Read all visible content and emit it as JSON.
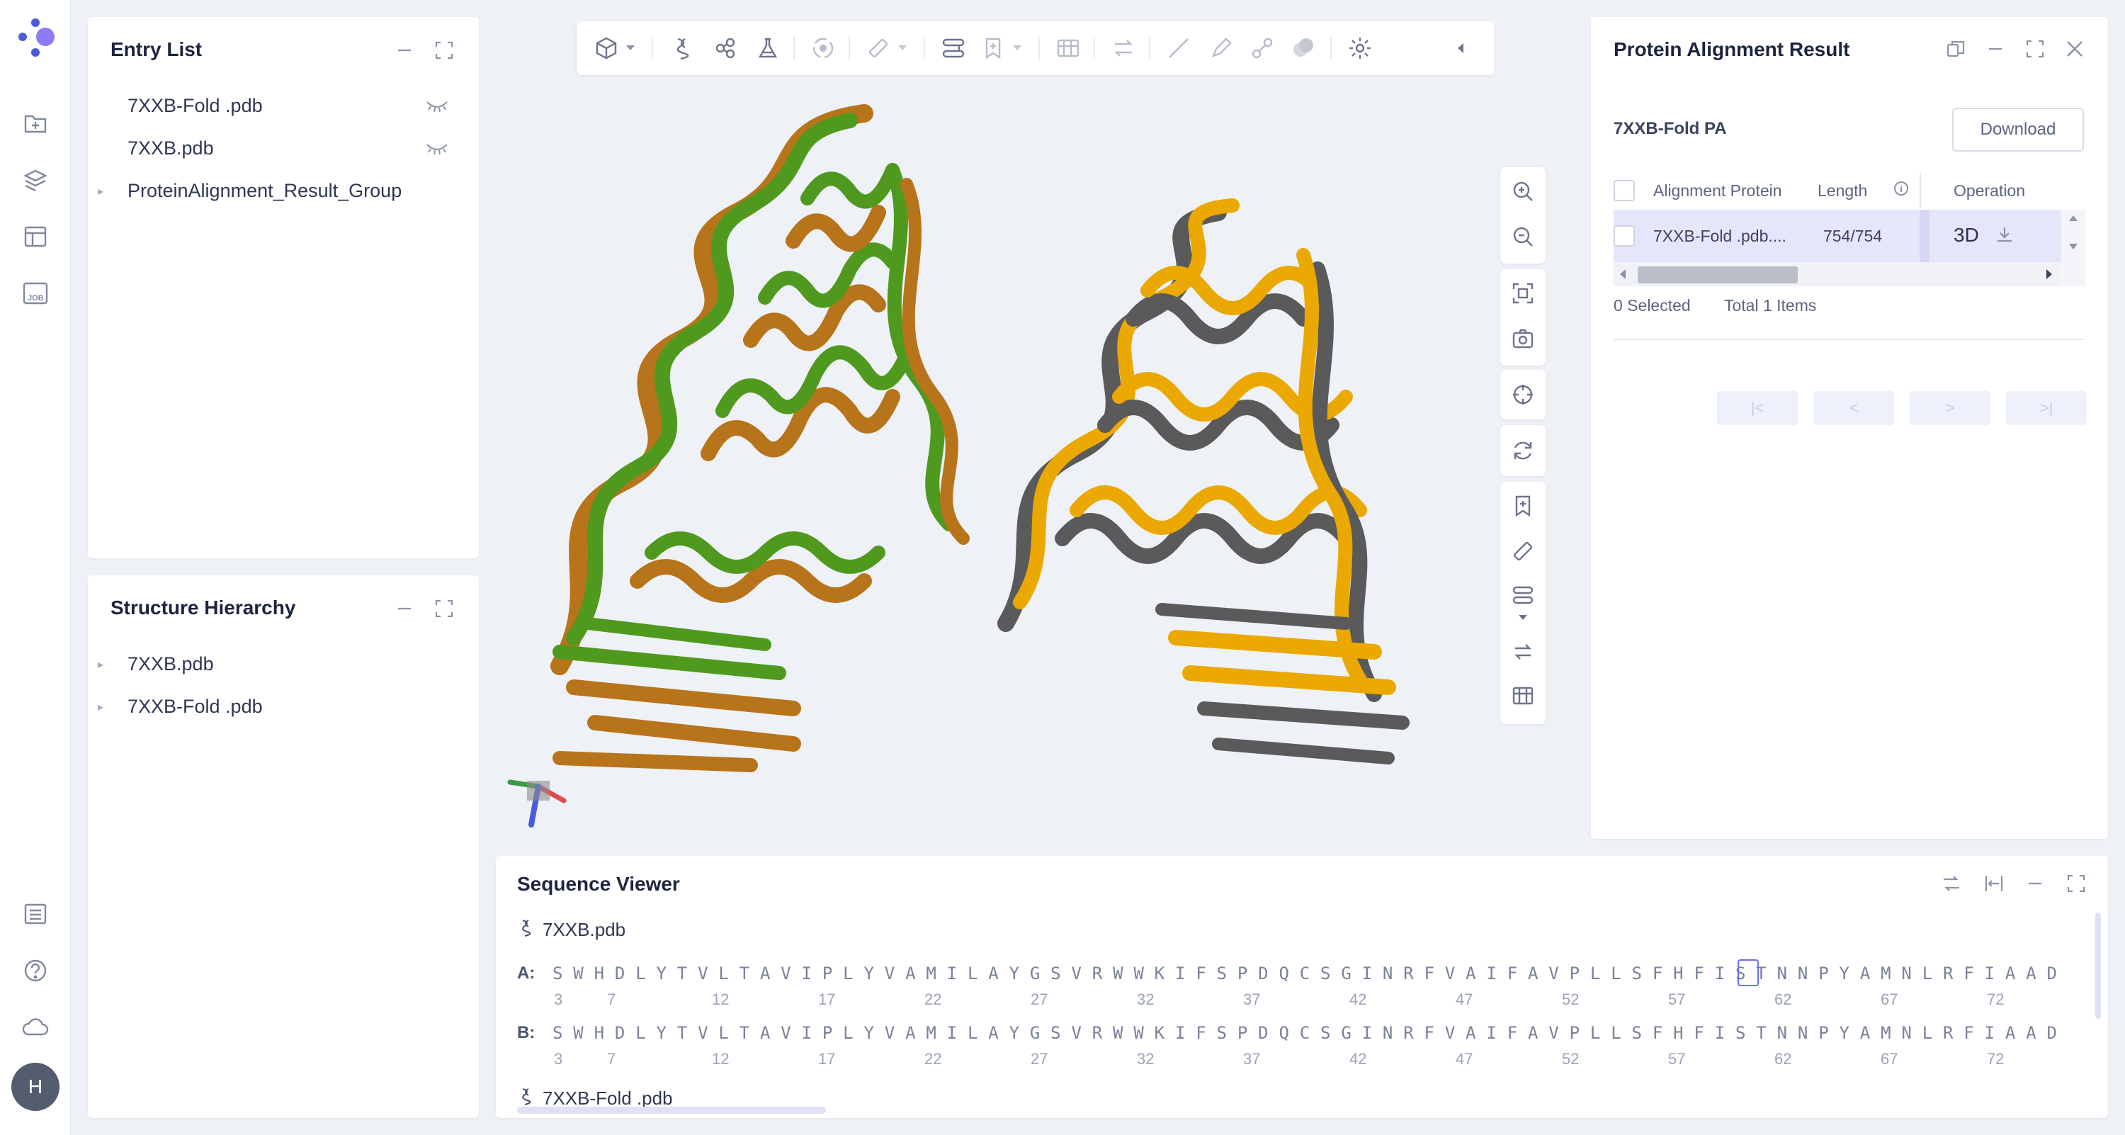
{
  "colors": {
    "accent": "#6c6cf5",
    "protein_green": "#4f9a1e",
    "protein_orange": "#b8741a",
    "protein_gold": "#eba800",
    "protein_gray": "#5a5a5a",
    "row_highlight": "#e5e6fb"
  },
  "rail": {
    "icons": [
      "logo-icon",
      "new-folder-icon",
      "layers-icon",
      "table-icon",
      "job-icon",
      "list-icon",
      "help-icon",
      "cloud-icon"
    ],
    "avatar_initial": "H"
  },
  "entry_list": {
    "title": "Entry List",
    "items": [
      {
        "label": "7XXB-Fold .pdb",
        "icon": "eye-closed-icon"
      },
      {
        "label": "7XXB.pdb",
        "icon": "eye-closed-icon"
      },
      {
        "label": "ProteinAlignment_Result_Group",
        "icon": "caret-right-icon"
      }
    ]
  },
  "structure_hierarchy": {
    "title": "Structure Hierarchy",
    "items": [
      {
        "label": "7XXB.pdb"
      },
      {
        "label": "7XXB-Fold .pdb"
      }
    ]
  },
  "toolbar": {
    "icons": [
      "cube-icon",
      "chevron-down-icon",
      "helix-icon",
      "molecule-icon",
      "flask-icon",
      "target-icon",
      "ruler-icon",
      "chevron-down-icon",
      "route-icon",
      "bookmark-icon",
      "chevron-down-icon",
      "map-icon",
      "swap-icon",
      "line-icon",
      "pencil-icon",
      "link-icon",
      "surface-icon",
      "settings-icon",
      "collapse-icon"
    ]
  },
  "viewer_tools": {
    "icons": [
      "zoom-in-icon",
      "zoom-out-icon",
      "fit-icon",
      "camera-icon",
      "crosshair-icon",
      "rotate-icon",
      "bookmark-add-icon",
      "ruler-icon",
      "route-icon",
      "swap-icon",
      "map-icon"
    ]
  },
  "alignment_result": {
    "title": "Protein Alignment Result",
    "subtitle": "7XXB-Fold PA",
    "download_label": "Download",
    "columns": [
      "Alignment Protein",
      "Length",
      "Operation"
    ],
    "rows": [
      {
        "protein": "7XXB-Fold .pdb....",
        "length": "754/754",
        "op_label": "3D"
      }
    ],
    "selected_text": "0 Selected",
    "total_text": "Total 1 Items",
    "pager": [
      "|<",
      "<",
      ">",
      ">|"
    ]
  },
  "sequence_viewer": {
    "title": "Sequence Viewer",
    "entries": [
      {
        "file": "7XXB.pdb",
        "chains": [
          {
            "id": "A:",
            "residues": "S W H D L Y T V L T A V I P L Y V A M I L A Y G S V R W W K I F S P D Q C S G I N R F V A I F A V P L L S F H F I S T N N P Y A M N L R F I A A D"
          },
          {
            "id": "B:",
            "residues": "S W H D L Y T V L T A V I P L Y V A M I L A Y G S V R W W K I F S P D Q C S G I N R F V A I F A V P L L S F H F I S T N N P Y A M N L R F I A A D"
          }
        ],
        "ticks": [
          "3",
          "7",
          "12",
          "17",
          "22",
          "27",
          "32",
          "37",
          "42",
          "47",
          "52",
          "57",
          "62",
          "67",
          "72"
        ]
      },
      {
        "file": "7XXB-Fold .pdb"
      }
    ]
  }
}
